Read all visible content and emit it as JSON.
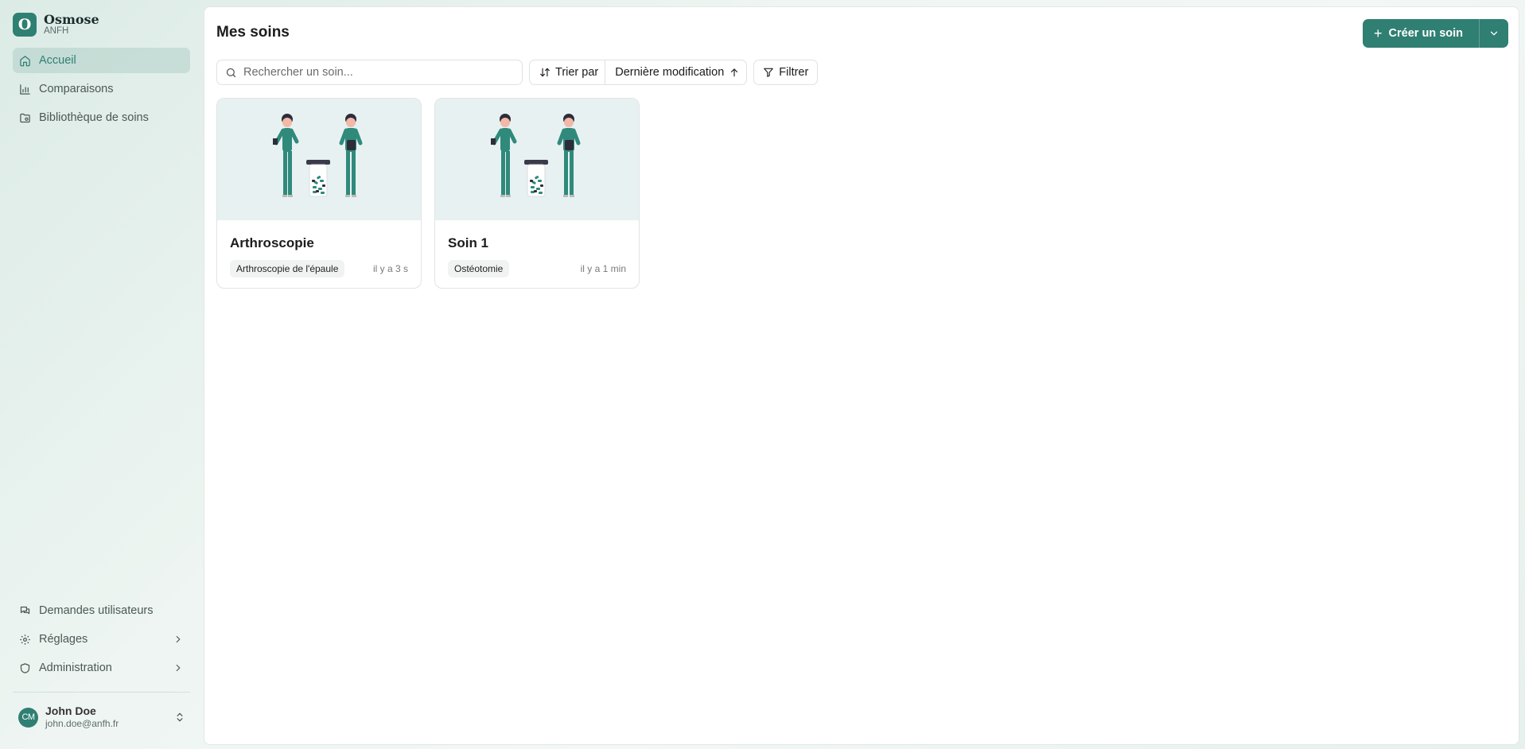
{
  "brand": {
    "name": "Osmose",
    "org": "ANFH",
    "logo_letter": "O"
  },
  "nav": {
    "items": [
      {
        "label": "Accueil",
        "icon": "home-icon",
        "active": true
      },
      {
        "label": "Comparaisons",
        "icon": "bar-chart-icon"
      },
      {
        "label": "Bibliothèque de soins",
        "icon": "folder-icon"
      }
    ],
    "bottom": [
      {
        "label": "Demandes utilisateurs",
        "icon": "messages-icon"
      },
      {
        "label": "Réglages",
        "icon": "gear-icon"
      },
      {
        "label": "Administration",
        "icon": "shield-icon"
      }
    ]
  },
  "user": {
    "initials": "CM",
    "name": "John Doe",
    "email": "john.doe@anfh.fr"
  },
  "page": {
    "title": "Mes soins"
  },
  "actions": {
    "create_label": "Créer un soin"
  },
  "toolbar": {
    "search_placeholder": "Rechercher un soin...",
    "sort_label": "Trier par",
    "sort_value": "Dernière modification",
    "filter_label": "Filtrer"
  },
  "cards": [
    {
      "title": "Arthroscopie",
      "tag": "Arthroscopie de l'épaule",
      "ago": "il y a 3 s"
    },
    {
      "title": "Soin 1",
      "tag": "Ostéotomie",
      "ago": "il y a 1 min"
    }
  ],
  "colors": {
    "accent": "#2f7f72",
    "accent_soft": "#a6c9c0",
    "card_bg": "#e8f1f1"
  }
}
